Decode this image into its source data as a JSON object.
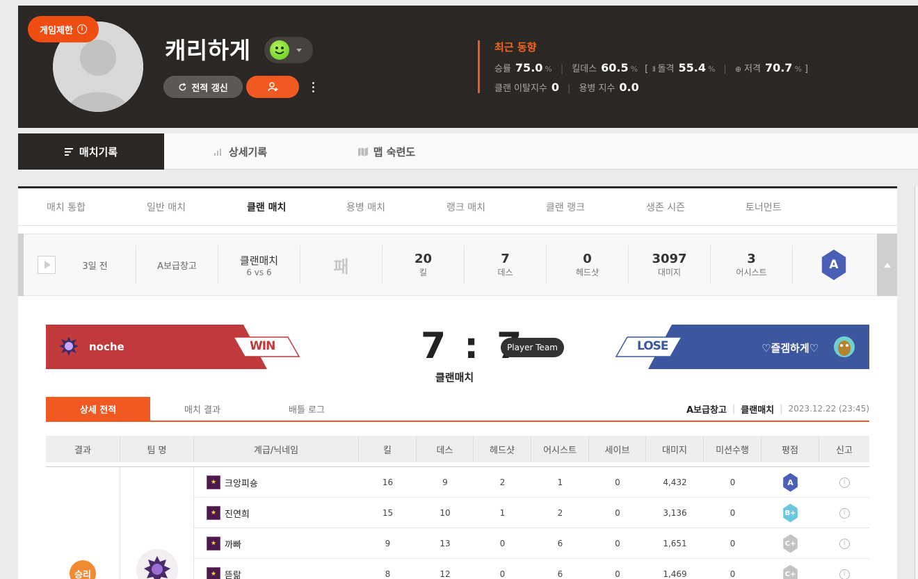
{
  "profile": {
    "restrict_label": "게임제한",
    "nickname": "캐리하게",
    "refresh_label": "전적 갱신",
    "recent_title": "최근 동향",
    "winrate_label": "승률",
    "winrate": "75.0",
    "kd_label": "킬데스",
    "kd": "60.5",
    "rifle_label": "돌격",
    "rifle": "55.4",
    "sniper_label": "저격",
    "sniper": "70.7",
    "unit": "%",
    "clan_leave_label": "클랜 이탈지수",
    "clan_leave": "0",
    "merc_label": "용병 지수",
    "merc": "0.0"
  },
  "tabs": [
    "매치기록",
    "상세기록",
    "맵 숙련도"
  ],
  "subtabs": [
    "매치 통합",
    "일반 매치",
    "클랜 매치",
    "용병 매치",
    "랭크 매치",
    "클랜 랭크",
    "생존 시즌",
    "토너먼트"
  ],
  "summary": {
    "ago": "3일 전",
    "map": "A보급창고",
    "mode": "클랜매치",
    "mode_sub": "6 vs 6",
    "result": "패",
    "kill": "20",
    "kill_label": "킬",
    "death": "7",
    "death_label": "데스",
    "headshot": "0",
    "headshot_label": "헤드샷",
    "damage": "3097",
    "damage_label": "대미지",
    "assist": "3",
    "assist_label": "어시스트",
    "grade": "A"
  },
  "match": {
    "win_team": "noche",
    "win_label": "WIN",
    "lose_team": "♡즐겜하게♡",
    "lose_label": "LOSE",
    "score": "7 : 7",
    "player_team": "Player Team",
    "type": "클랜매치",
    "detail_tabs": [
      "상세 전적",
      "매치 결과",
      "배틀 로그"
    ],
    "map": "A보급창고",
    "mode": "클랜매치",
    "date": "2023.12.22 (23:45)"
  },
  "table": {
    "headers": [
      "결과",
      "팀 명",
      "계급/닉네임",
      "킬",
      "데스",
      "헤드샷",
      "어시스트",
      "세이브",
      "대미지",
      "미션수행",
      "평점",
      "신고"
    ],
    "result_label": "승리",
    "rows": [
      {
        "name": "크앙피숑",
        "kill": "16",
        "death": "9",
        "hs": "2",
        "assist": "1",
        "save": "0",
        "damage": "4,432",
        "mission": "0",
        "grade": "A",
        "color": "#4a5fb5"
      },
      {
        "name": "진연희",
        "kill": "15",
        "death": "10",
        "hs": "1",
        "assist": "2",
        "save": "0",
        "damage": "3,136",
        "mission": "0",
        "grade": "B+",
        "color": "#6cc7dc"
      },
      {
        "name": "까빠",
        "kill": "9",
        "death": "13",
        "hs": "0",
        "assist": "6",
        "save": "0",
        "damage": "1,651",
        "mission": "0",
        "grade": "C+",
        "color": "#c4c4c4"
      },
      {
        "name": "뜯랆",
        "kill": "8",
        "death": "12",
        "hs": "0",
        "assist": "6",
        "save": "0",
        "damage": "1,469",
        "mission": "0",
        "grade": "C+",
        "color": "#c4c4c4"
      }
    ]
  },
  "colors": {
    "accent": "#f05a22",
    "header_bg": "#2a2724",
    "win": "#c0393b",
    "lose": "#3c57a0"
  }
}
